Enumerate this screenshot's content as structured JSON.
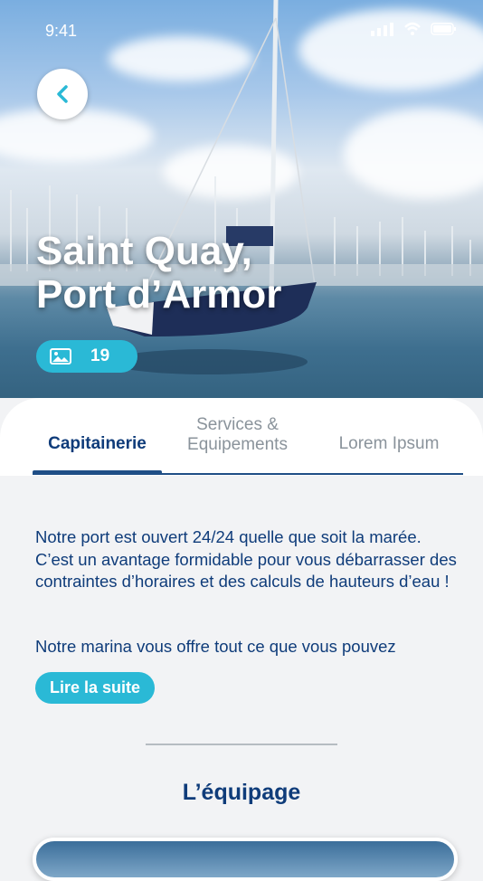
{
  "status": {
    "time": "9:41"
  },
  "hero": {
    "title_line1": "Saint Quay,",
    "title_line2": "Port d’Armor",
    "photo_count": "19"
  },
  "tabs": [
    {
      "label": "Capitainerie"
    },
    {
      "label_line1": "Services &",
      "label_line2": "Equipements"
    },
    {
      "label": "Lorem Ipsum"
    }
  ],
  "content": {
    "paragraph1": "Notre port est ouvert 24/24 quelle que soit la marée. C’est un avantage formidable pour vous débarrasser des contraintes d’horaires et des calculs de hauteurs d’eau !",
    "paragraph2": "Notre marina vous offre tout ce que vous pouvez",
    "read_more": "Lire la suite"
  },
  "crew_section": {
    "title": "L’équipage"
  },
  "colors": {
    "accent": "#2ab9d6",
    "navy": "#0f3c7a"
  }
}
